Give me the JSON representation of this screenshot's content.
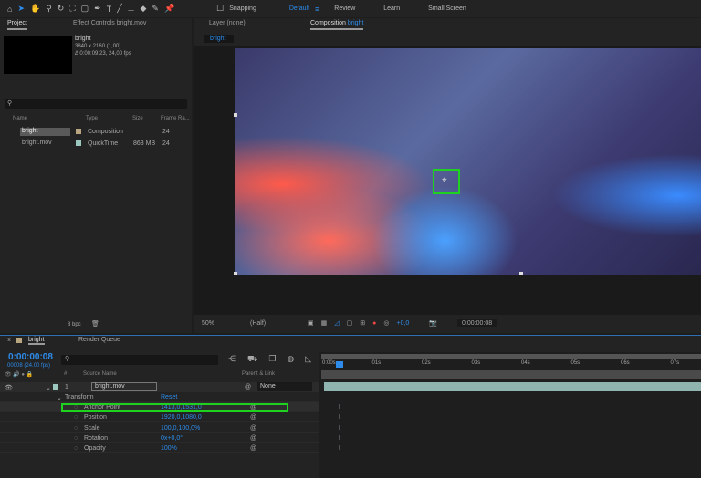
{
  "toolbar": {
    "snapping": "Snapping",
    "workspaces": [
      "Default",
      "Review",
      "Learn",
      "Small Screen"
    ]
  },
  "project": {
    "tab": "Project",
    "effect_controls_tab": "Effect Controls bright.mov",
    "selected": {
      "name": "bright",
      "dimensions": "3840 x 2160 (1,00)",
      "duration": "Δ 0:00:09:23, 24,00 fps"
    },
    "columns": [
      "Name",
      "Type",
      "Size",
      "Frame Ra..."
    ],
    "items": [
      {
        "name": "bright",
        "type": "Composition",
        "size": "",
        "fps": "24",
        "color": "#b9a57f"
      },
      {
        "name": "bright.mov",
        "type": "QuickTime",
        "size": "863 MB",
        "fps": "24",
        "color": "#9cc8c0"
      }
    ],
    "bpc": "8 bpc"
  },
  "comp": {
    "layer_tab": "Layer (none)",
    "comp_tab_prefix": "Composition",
    "comp_name": "bright",
    "breadcrumb": "bright",
    "zoom": "50%",
    "resolution": "(Half)",
    "exposure": "+0,0",
    "timecode": "0:00:00:08"
  },
  "timeline": {
    "tab": "bright",
    "render_queue": "Render Queue",
    "timecode": "0:00:00:08",
    "frame_info": "00008 (24.00 fps)",
    "columns": {
      "num": "#",
      "source": "Source Name",
      "parent": "Parent & Link"
    },
    "ruler": [
      "0:00s",
      "01s",
      "02s",
      "03s",
      "04s",
      "05s",
      "06s",
      "07s"
    ],
    "layer": {
      "index": "1",
      "name": "bright.mov",
      "parent": "None"
    },
    "transform": {
      "label": "Transform",
      "reset": "Reset"
    },
    "properties": [
      {
        "name": "Anchor Point",
        "value": "1413,0,1531,0"
      },
      {
        "name": "Position",
        "value": "1920,0,1080,0"
      },
      {
        "name": "Scale",
        "value": "100,0,100,0%"
      },
      {
        "name": "Rotation",
        "value": "0x+0,0°"
      },
      {
        "name": "Opacity",
        "value": "100%"
      }
    ]
  }
}
